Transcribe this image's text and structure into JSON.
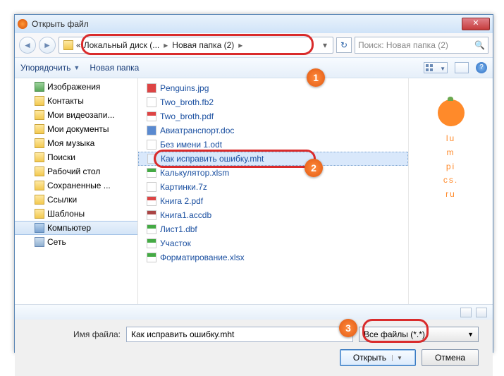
{
  "title": "Открыть файл",
  "close_x": "✕",
  "breadcrumb": {
    "root": "«",
    "seg1": "Локальный диск (...",
    "seg2": "Новая папка (2)"
  },
  "search_placeholder": "Поиск: Новая папка (2)",
  "toolbar": {
    "organize": "Упорядочить",
    "newfolder": "Новая папка"
  },
  "tree": [
    {
      "label": "Изображения",
      "cls": "ic-img"
    },
    {
      "label": "Контакты",
      "cls": "ic-folder"
    },
    {
      "label": "Мои видеозапи...",
      "cls": "ic-folder"
    },
    {
      "label": "Мои документы",
      "cls": "ic-folder"
    },
    {
      "label": "Моя музыка",
      "cls": "ic-folder"
    },
    {
      "label": "Поиски",
      "cls": "ic-folder"
    },
    {
      "label": "Рабочий стол",
      "cls": "ic-folder"
    },
    {
      "label": "Сохраненные ...",
      "cls": "ic-folder"
    },
    {
      "label": "Ссылки",
      "cls": "ic-folder"
    },
    {
      "label": "Шаблоны",
      "cls": "ic-folder"
    },
    {
      "label": "Компьютер",
      "cls": "ic-comp",
      "sel": true
    },
    {
      "label": "Сеть",
      "cls": "ic-net"
    }
  ],
  "files": [
    {
      "name": "Penguins.jpg",
      "cls": "fic-jpg"
    },
    {
      "name": "Two_broth.fb2",
      "cls": "fic-fb2"
    },
    {
      "name": "Two_broth.pdf",
      "cls": "fic-pdf"
    },
    {
      "name": "Авиатранспорт.doc",
      "cls": "fic-doc"
    },
    {
      "name": "Без имени 1.odt",
      "cls": "fic-odt"
    },
    {
      "name": "Как исправить ошибку.mht",
      "cls": "fic-mht",
      "sel": true
    },
    {
      "name": "Калькулятор.xlsm",
      "cls": "fic-xlsm"
    },
    {
      "name": "Картинки.7z",
      "cls": "fic-7z"
    },
    {
      "name": "Книга 2.pdf",
      "cls": "fic-pdf"
    },
    {
      "name": "Книга1.accdb",
      "cls": "pic-accdb"
    },
    {
      "name": "Лист1.dbf",
      "cls": "fic-dbf"
    },
    {
      "name": "Участок",
      "cls": "fic-xlsx"
    },
    {
      "name": "Форматирование.xlsx",
      "cls": "fic-xlsx"
    }
  ],
  "watermark": [
    "lu",
    "m",
    "pi",
    "cs.",
    "ru"
  ],
  "filename_label": "Имя файла:",
  "filename_value": "Как исправить ошибку.mht",
  "filter_label": "Все файлы (*.*)",
  "open_label": "Открыть",
  "cancel_label": "Отмена",
  "ann": {
    "n1": "1",
    "n2": "2",
    "n3": "3"
  }
}
